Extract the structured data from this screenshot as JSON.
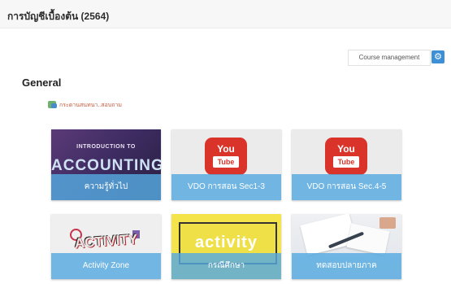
{
  "header": {
    "course_title": "การบัญชีเบื้องต้น (2564)"
  },
  "toolbar": {
    "course_management_label": "Course management",
    "gear_icon": "gear-icon"
  },
  "section": {
    "title": "General"
  },
  "forum": {
    "icon": "forum-icon",
    "link_text": "กระดานสนทนา..สอบถาม"
  },
  "tiles": [
    {
      "label": "ความรู้ทั่วไป",
      "image_text_1": "INTRODUCTION TO",
      "image_text_2": "ACCOUNTING"
    },
    {
      "label": "VDO การสอน Sec1-3",
      "image_text_1": "You",
      "image_text_2": "Tube"
    },
    {
      "label": "VDO การสอน Sec.4-5",
      "image_text_1": "You",
      "image_text_2": "Tube"
    },
    {
      "label": "Activity Zone",
      "image_text_1": "ACTIVITY"
    },
    {
      "label": "กรณีศึกษา",
      "image_text_1": "activity"
    },
    {
      "label": "ทดสอบปลายภาค"
    }
  ],
  "colors": {
    "accent": "#3d8fd6",
    "tile_label_bg": "#56aae0",
    "forum_link": "#c45a3b"
  }
}
